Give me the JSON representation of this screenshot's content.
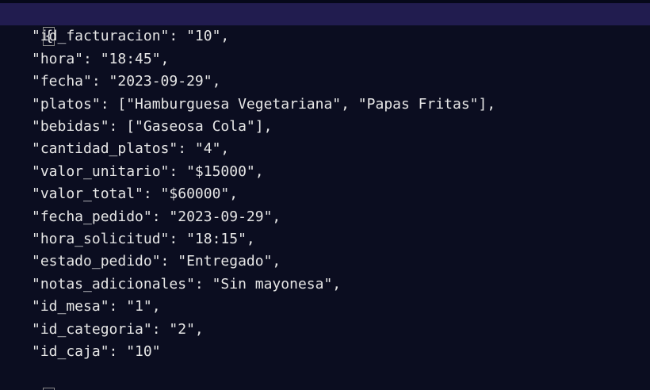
{
  "open_brace": "{",
  "close_brace": "}",
  "lines": [
    "\"id_facturacion\": \"10\",",
    "\"hora\": \"18:45\",",
    "\"fecha\": \"2023-09-29\",",
    "\"platos\": [\"Hamburguesa Vegetariana\", \"Papas Fritas\"],",
    "\"bebidas\": [\"Gaseosa Cola\"],",
    "\"cantidad_platos\": \"4\",",
    "\"valor_unitario\": \"$15000\",",
    "\"valor_total\": \"$60000\",",
    "\"fecha_pedido\": \"2023-09-29\",",
    "\"hora_solicitud\": \"18:15\",",
    "\"estado_pedido\": \"Entregado\",",
    "\"notas_adicionales\": \"Sin mayonesa\",",
    "\"id_mesa\": \"1\",",
    "\"id_categoria\": \"2\",",
    "\"id_caja\": \"10\""
  ]
}
